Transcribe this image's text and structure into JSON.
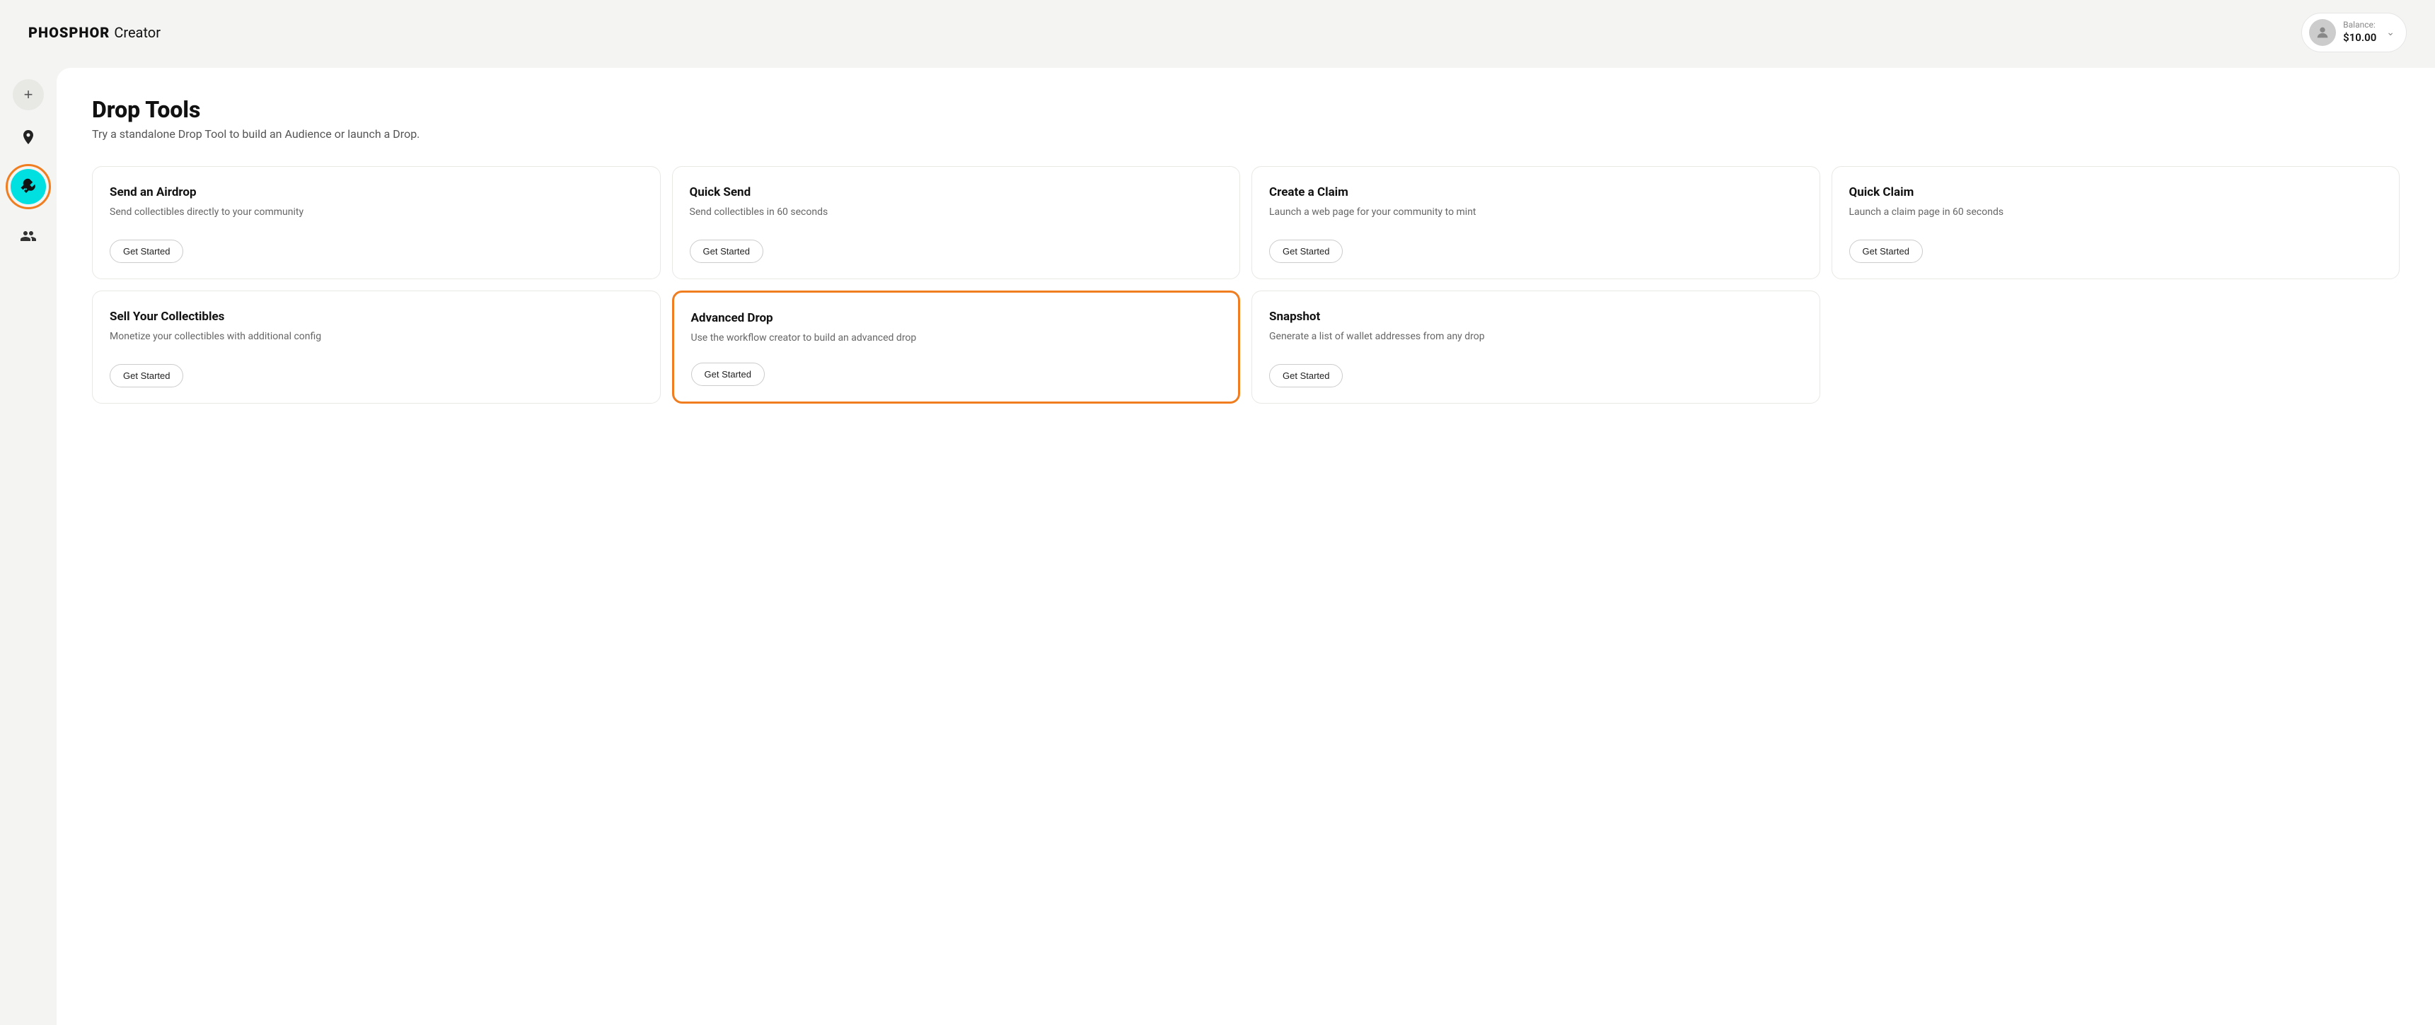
{
  "header": {
    "logo_bold": "PHOSPHOR",
    "logo_regular": "Creator",
    "balance_label": "Balance:",
    "balance_amount": "$10.00"
  },
  "sidebar": {
    "add_label": "+",
    "icons": [
      "home",
      "tool",
      "people"
    ]
  },
  "page": {
    "title": "Drop Tools",
    "subtitle": "Try a standalone Drop Tool to build an Audience or launch a Drop."
  },
  "cards_row1": [
    {
      "id": "send-airdrop",
      "title": "Send an Airdrop",
      "desc": "Send collectibles directly to your community",
      "btn": "Get Started",
      "highlighted": false
    },
    {
      "id": "quick-send",
      "title": "Quick Send",
      "desc": "Send collectibles in 60 seconds",
      "btn": "Get Started",
      "highlighted": false
    },
    {
      "id": "create-claim",
      "title": "Create a Claim",
      "desc": "Launch a web page for your community to mint",
      "btn": "Get Started",
      "highlighted": false
    },
    {
      "id": "quick-claim",
      "title": "Quick Claim",
      "desc": "Launch a claim page in 60 seconds",
      "btn": "Get Started",
      "highlighted": false
    }
  ],
  "cards_row2": [
    {
      "id": "sell-collectibles",
      "title": "Sell Your Collectibles",
      "desc": "Monetize your collectibles with additional config",
      "btn": "Get Started",
      "highlighted": false
    },
    {
      "id": "advanced-drop",
      "title": "Advanced Drop",
      "desc": "Use the workflow creator to build an advanced drop",
      "btn": "Get Started",
      "highlighted": true
    },
    {
      "id": "snapshot",
      "title": "Snapshot",
      "desc": "Generate a list of wallet addresses from any drop",
      "btn": "Get Started",
      "highlighted": false
    }
  ]
}
